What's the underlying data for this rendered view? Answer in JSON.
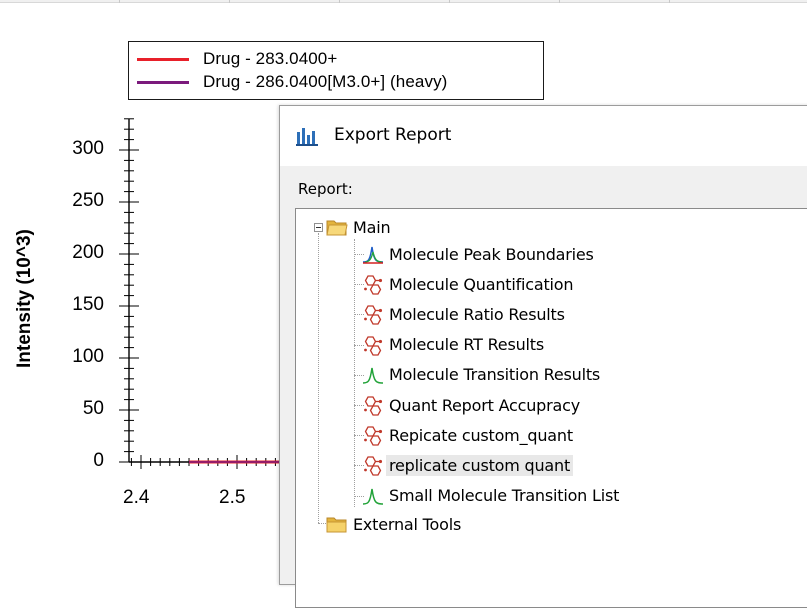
{
  "chart": {
    "y_axis_title": "Intensity (10^3)",
    "y_ticks": [
      "300",
      "250",
      "200",
      "150",
      "100",
      "50",
      "0"
    ],
    "x_ticks": [
      "2.4",
      "2.5"
    ],
    "legend": [
      {
        "label": "Drug - 283.0400+",
        "color": "#e8202a"
      },
      {
        "label": "Drug - 286.0400[M3.0+] (heavy)",
        "color": "#7b1a7c"
      }
    ]
  },
  "chart_data": {
    "type": "line",
    "title": "",
    "xlabel": "",
    "ylabel": "Intensity (10^3)",
    "ylim": [
      0,
      330
    ],
    "x_ticks": [
      2.4,
      2.5
    ],
    "y_ticks": [
      0,
      50,
      100,
      150,
      200,
      250,
      300
    ],
    "series": [
      {
        "name": "Drug - 283.0400+",
        "color": "#e8202a",
        "x": [
          2.45,
          2.55
        ],
        "y": [
          0,
          0
        ]
      },
      {
        "name": "Drug - 286.0400[M3.0+] (heavy)",
        "color": "#7b1a7c",
        "x": [
          2.45,
          2.55
        ],
        "y": [
          0,
          0
        ]
      }
    ],
    "legend_position": "top"
  },
  "dialog": {
    "title": "Export Report",
    "report_label": "Report:",
    "tree": {
      "root": {
        "label": "Main",
        "icon": "folder-open-icon"
      },
      "children": [
        {
          "label": "Molecule Peak Boundaries",
          "icon": "peak-boundaries-icon"
        },
        {
          "label": "Molecule Quantification",
          "icon": "molecule-icon"
        },
        {
          "label": "Molecule Ratio Results",
          "icon": "molecule-icon"
        },
        {
          "label": "Molecule RT Results",
          "icon": "molecule-icon"
        },
        {
          "label": "Molecule Transition Results",
          "icon": "transition-peak-icon"
        },
        {
          "label": "Quant Report Accupracy",
          "icon": "molecule-icon"
        },
        {
          "label": "Repicate custom_quant",
          "icon": "molecule-icon"
        },
        {
          "label": "replicate custom quant",
          "icon": "molecule-icon",
          "selected": true
        },
        {
          "label": "Small Molecule Transition List",
          "icon": "transition-peak-icon"
        }
      ],
      "sibling": {
        "label": "External Tools",
        "icon": "folder-icon"
      }
    }
  }
}
